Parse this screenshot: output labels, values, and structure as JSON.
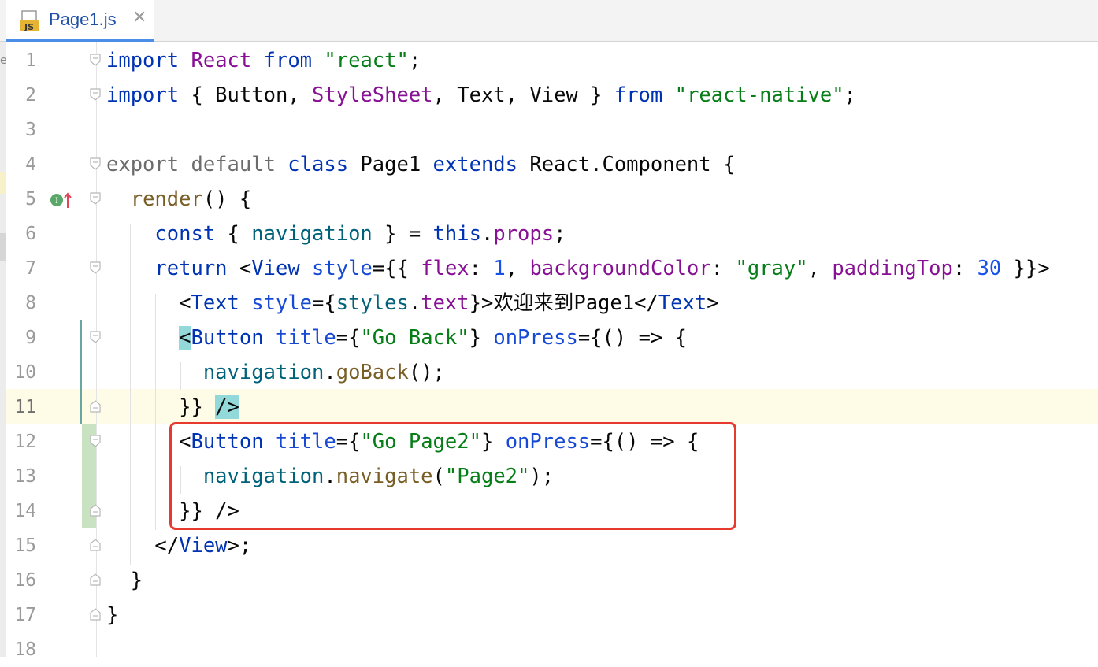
{
  "tab": {
    "icon_text": "JS",
    "label": "Page1.js",
    "close": "✕"
  },
  "colors": {
    "keyword": "#0033b3",
    "string": "#067d17",
    "highlight_box": "#e8392f",
    "tab_underline": "#4a8ee8"
  },
  "lines": [
    {
      "n": "1",
      "tokens": [
        [
          "kw",
          "import"
        ],
        [
          "t",
          " "
        ],
        [
          "ident",
          "React"
        ],
        [
          "t",
          " "
        ],
        [
          "kw",
          "from"
        ],
        [
          "t",
          " "
        ],
        [
          "str",
          "\"react\""
        ],
        [
          "t",
          ";"
        ]
      ]
    },
    {
      "n": "2",
      "tokens": [
        [
          "kw",
          "import"
        ],
        [
          "t",
          " { Button, "
        ],
        [
          "ident",
          "StyleSheet"
        ],
        [
          "t",
          ", Text, View } "
        ],
        [
          "kw",
          "from"
        ],
        [
          "t",
          " "
        ],
        [
          "str",
          "\"react-native\""
        ],
        [
          "t",
          ";"
        ]
      ]
    },
    {
      "n": "3",
      "tokens": []
    },
    {
      "n": "4",
      "tokens": [
        [
          "kwg",
          "export default"
        ],
        [
          "t",
          " "
        ],
        [
          "kw",
          "class"
        ],
        [
          "t",
          " Page1 "
        ],
        [
          "kw",
          "extends"
        ],
        [
          "t",
          " React.Component {"
        ]
      ]
    },
    {
      "n": "5",
      "tokens": [
        [
          "t",
          "  "
        ],
        [
          "meth",
          "render"
        ],
        [
          "t",
          "() {"
        ]
      ]
    },
    {
      "n": "6",
      "tokens": [
        [
          "t",
          "    "
        ],
        [
          "kw",
          "const"
        ],
        [
          "t",
          " { "
        ],
        [
          "fn",
          "navigation"
        ],
        [
          "t",
          " } = "
        ],
        [
          "kw",
          "this"
        ],
        [
          "t",
          "."
        ],
        [
          "ident",
          "props"
        ],
        [
          "t",
          ";"
        ]
      ]
    },
    {
      "n": "7",
      "tokens": [
        [
          "t",
          "    "
        ],
        [
          "kw",
          "return"
        ],
        [
          "t",
          " <"
        ],
        [
          "jsx",
          "View"
        ],
        [
          "t",
          " "
        ],
        [
          "attr",
          "style"
        ],
        [
          "t",
          "="
        ],
        [
          "t",
          "{{ "
        ],
        [
          "ident",
          "flex"
        ],
        [
          "t",
          ": "
        ],
        [
          "num",
          "1"
        ],
        [
          "t",
          ", "
        ],
        [
          "ident",
          "backgroundColor"
        ],
        [
          "t",
          ": "
        ],
        [
          "str",
          "\"gray\""
        ],
        [
          "t",
          ", "
        ],
        [
          "ident",
          "paddingTop"
        ],
        [
          "t",
          ": "
        ],
        [
          "num",
          "30"
        ],
        [
          "t",
          " }}>"
        ]
      ]
    },
    {
      "n": "8",
      "tokens": [
        [
          "t",
          "      <"
        ],
        [
          "jsx",
          "Text"
        ],
        [
          "t",
          " "
        ],
        [
          "attr",
          "style"
        ],
        [
          "t",
          "={"
        ],
        [
          "fn",
          "styles"
        ],
        [
          "t",
          "."
        ],
        [
          "ident",
          "text"
        ],
        [
          "t",
          "}>欢迎来到Page1</"
        ],
        [
          "jsx",
          "Text"
        ],
        [
          "t",
          ">"
        ]
      ]
    },
    {
      "n": "9",
      "tokens": [
        [
          "t",
          "      "
        ],
        [
          "hl",
          "<"
        ],
        [
          "jsx",
          "Button"
        ],
        [
          "t",
          " "
        ],
        [
          "attr",
          "title"
        ],
        [
          "t",
          "={"
        ],
        [
          "str",
          "\"Go Back\""
        ],
        [
          "t",
          "} "
        ],
        [
          "attr",
          "onPress"
        ],
        [
          "t",
          "={() => {"
        ]
      ]
    },
    {
      "n": "10",
      "tokens": [
        [
          "t",
          "        "
        ],
        [
          "fn",
          "navigation"
        ],
        [
          "t",
          "."
        ],
        [
          "meth",
          "goBack"
        ],
        [
          "t",
          "();"
        ]
      ]
    },
    {
      "n": "11",
      "tokens": [
        [
          "t",
          "      }} "
        ],
        [
          "hl",
          "/>"
        ]
      ]
    },
    {
      "n": "12",
      "tokens": [
        [
          "t",
          "      <"
        ],
        [
          "jsx",
          "Button"
        ],
        [
          "t",
          " "
        ],
        [
          "attr",
          "title"
        ],
        [
          "t",
          "={"
        ],
        [
          "str",
          "\"Go Page2\""
        ],
        [
          "t",
          "} "
        ],
        [
          "attr",
          "onPress"
        ],
        [
          "t",
          "={() => {"
        ]
      ]
    },
    {
      "n": "13",
      "tokens": [
        [
          "t",
          "        "
        ],
        [
          "fn",
          "navigation"
        ],
        [
          "t",
          "."
        ],
        [
          "meth",
          "navigate"
        ],
        [
          "t",
          "("
        ],
        [
          "str",
          "\"Page2\""
        ],
        [
          "t",
          ");"
        ]
      ]
    },
    {
      "n": "14",
      "tokens": [
        [
          "t",
          "      }} />"
        ]
      ]
    },
    {
      "n": "15",
      "tokens": [
        [
          "t",
          "    </"
        ],
        [
          "jsx",
          "View"
        ],
        [
          "t",
          ">;"
        ]
      ]
    },
    {
      "n": "16",
      "tokens": [
        [
          "t",
          "  }"
        ]
      ]
    },
    {
      "n": "17",
      "tokens": [
        [
          "t",
          "}"
        ]
      ]
    },
    {
      "n": "18",
      "tokens": []
    }
  ]
}
